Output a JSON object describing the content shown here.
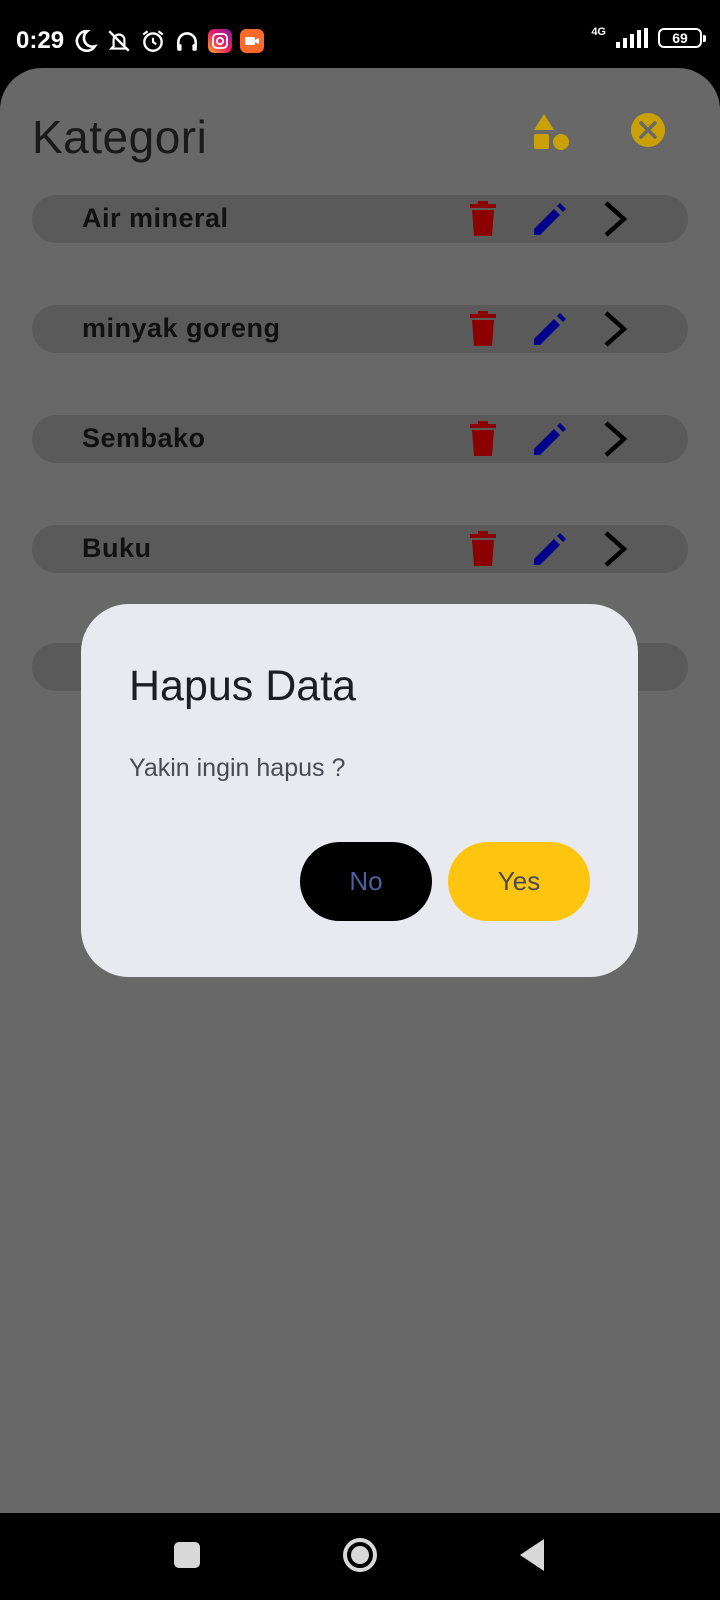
{
  "status_bar": {
    "time": "0:29",
    "network": "4G",
    "battery": "69",
    "icons": [
      "moon-icon",
      "vibrate-off-icon",
      "alarm-icon",
      "headphones-icon",
      "instagram-icon",
      "video-recorder-icon"
    ]
  },
  "header": {
    "title": "Kategori",
    "accent_color": "#c9a006"
  },
  "categories": [
    {
      "label": "Air mineral"
    },
    {
      "label": "minyak goreng"
    },
    {
      "label": "Sembako"
    },
    {
      "label": "Buku"
    },
    {
      "label": ""
    }
  ],
  "colors": {
    "delete": "#8b0000",
    "edit": "#00008b",
    "yes_button": "#fec510"
  },
  "dialog": {
    "title": "Hapus Data",
    "message": "Yakin ingin hapus ?",
    "no_label": "No",
    "yes_label": "Yes"
  }
}
